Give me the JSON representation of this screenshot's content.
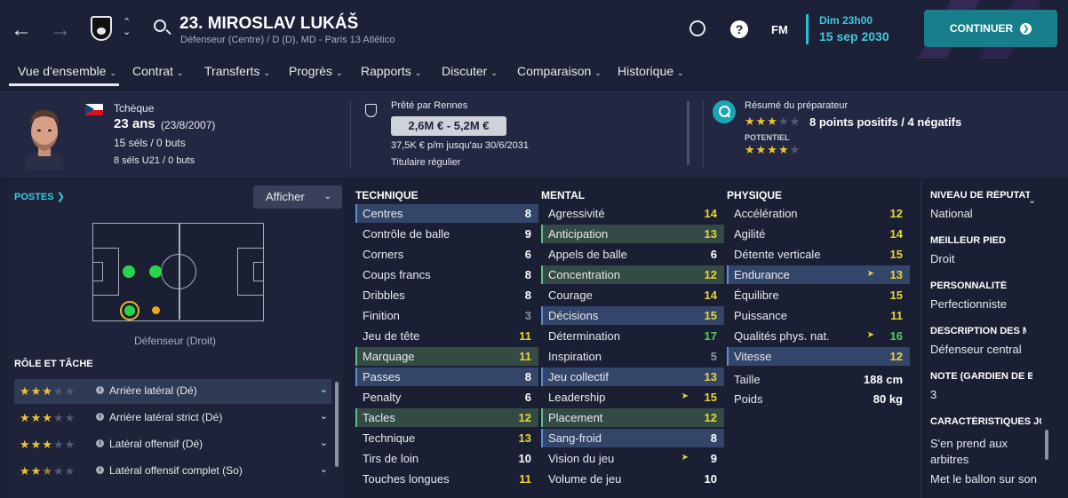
{
  "header": {
    "player_name": "23. MIROSLAV LUKÁŠ",
    "player_sub": "Défenseur (Centre) / D (D), MD - Paris 13 Atlético",
    "date_day": "Dim 23h00",
    "date_date": "15 sep 2030",
    "continue_label": "CONTINUER",
    "fm_label": "FM",
    "help_label": "?"
  },
  "tabs": [
    {
      "label": "Vue d'ensemble"
    },
    {
      "label": "Contrat"
    },
    {
      "label": "Transferts"
    },
    {
      "label": "Progrès"
    },
    {
      "label": "Rapports"
    },
    {
      "label": "Discuter"
    },
    {
      "label": "Comparaison"
    },
    {
      "label": "Historique"
    }
  ],
  "info": {
    "nationality": "Tchèque",
    "age": "23 ans",
    "dob": "(23/8/2007)",
    "caps": "15 séls / 0 buts",
    "u21_caps": "8 séls U21 / 0 buts",
    "loan_label": "Prêté par Rennes",
    "value": "2,6M € - 5,2M €",
    "wage": "37,5K € p/m jusqu'au 30/6/2031",
    "status": "Titulaire régulier",
    "scout_title": "Résumé du préparateur",
    "scout_summary": "8 points positifs / 4 négatifs",
    "potential_label": "POTENTIEL",
    "ability_stars": 3,
    "potential_stars": 4
  },
  "positions": {
    "title": "POSTES",
    "show_label": "Afficher",
    "position_label": "Défenseur (Droit)"
  },
  "roles": {
    "title": "RÔLE ET TÂCHE",
    "items": [
      {
        "label": "Arrière latéral (Dé)",
        "stars": 3
      },
      {
        "label": "Arrière latéral strict (Dé)",
        "stars": 3
      },
      {
        "label": "Latéral offensif (Dé)",
        "stars": 3
      },
      {
        "label": "Latéral offensif complet (So)",
        "stars": 2.5
      }
    ]
  },
  "technique": {
    "title": "TECHNIQUE",
    "rows": [
      {
        "name": "Centres",
        "value": "8"
      },
      {
        "name": "Contrôle de balle",
        "value": "9"
      },
      {
        "name": "Corners",
        "value": "6"
      },
      {
        "name": "Coups francs",
        "value": "8"
      },
      {
        "name": "Dribbles",
        "value": "8"
      },
      {
        "name": "Finition",
        "value": "3"
      },
      {
        "name": "Jeu de tête",
        "value": "11"
      },
      {
        "name": "Marquage",
        "value": "11"
      },
      {
        "name": "Passes",
        "value": "8"
      },
      {
        "name": "Penalty",
        "value": "6"
      },
      {
        "name": "Tacles",
        "value": "12"
      },
      {
        "name": "Technique",
        "value": "13"
      },
      {
        "name": "Tirs de loin",
        "value": "10"
      },
      {
        "name": "Touches longues",
        "value": "11"
      }
    ]
  },
  "mental": {
    "title": "MENTAL",
    "rows": [
      {
        "name": "Agressivité",
        "value": "14"
      },
      {
        "name": "Anticipation",
        "value": "13"
      },
      {
        "name": "Appels de balle",
        "value": "6"
      },
      {
        "name": "Concentration",
        "value": "12"
      },
      {
        "name": "Courage",
        "value": "14"
      },
      {
        "name": "Décisions",
        "value": "15"
      },
      {
        "name": "Détermination",
        "value": "17"
      },
      {
        "name": "Inspiration",
        "value": "5"
      },
      {
        "name": "Jeu collectif",
        "value": "13"
      },
      {
        "name": "Leadership",
        "value": "15"
      },
      {
        "name": "Placement",
        "value": "12"
      },
      {
        "name": "Sang-froid",
        "value": "8"
      },
      {
        "name": "Vision du jeu",
        "value": "9"
      },
      {
        "name": "Volume de jeu",
        "value": "10"
      }
    ]
  },
  "physique": {
    "title": "PHYSIQUE",
    "rows": [
      {
        "name": "Accélération",
        "value": "12"
      },
      {
        "name": "Agilité",
        "value": "14"
      },
      {
        "name": "Détente verticale",
        "value": "15"
      },
      {
        "name": "Endurance",
        "value": "13"
      },
      {
        "name": "Équilibre",
        "value": "15"
      },
      {
        "name": "Puissance",
        "value": "11"
      },
      {
        "name": "Qualités phys. nat.",
        "value": "16"
      },
      {
        "name": "Vitesse",
        "value": "12"
      }
    ],
    "height_label": "Taille",
    "height": "188 cm",
    "weight_label": "Poids",
    "weight": "80 kg"
  },
  "details": {
    "reputation_h": "NIVEAU DE RÉPUTATION",
    "reputation": "National",
    "foot_h": "MEILLEUR PIED",
    "foot": "Droit",
    "personality_h": "PERSONNALITÉ",
    "personality": "Perfectionniste",
    "media_h": "DESCRIPTION DES MÉDIAS",
    "media": "Défenseur central",
    "gk_h": "NOTE (GARDIEN DE BUT)",
    "gk": "3",
    "traits_h": "CARACTÉRISTIQUES JOUEUR",
    "trait1a": "S'en prend aux",
    "trait1b": "arbitres",
    "trait2": "Met le ballon sur son"
  },
  "colors": {
    "accent": "#1fc2d6",
    "continue_bg": "#167f8b",
    "star": "#f2c230",
    "value_yellow": "#e9d534",
    "value_green": "#4ccf5b"
  }
}
